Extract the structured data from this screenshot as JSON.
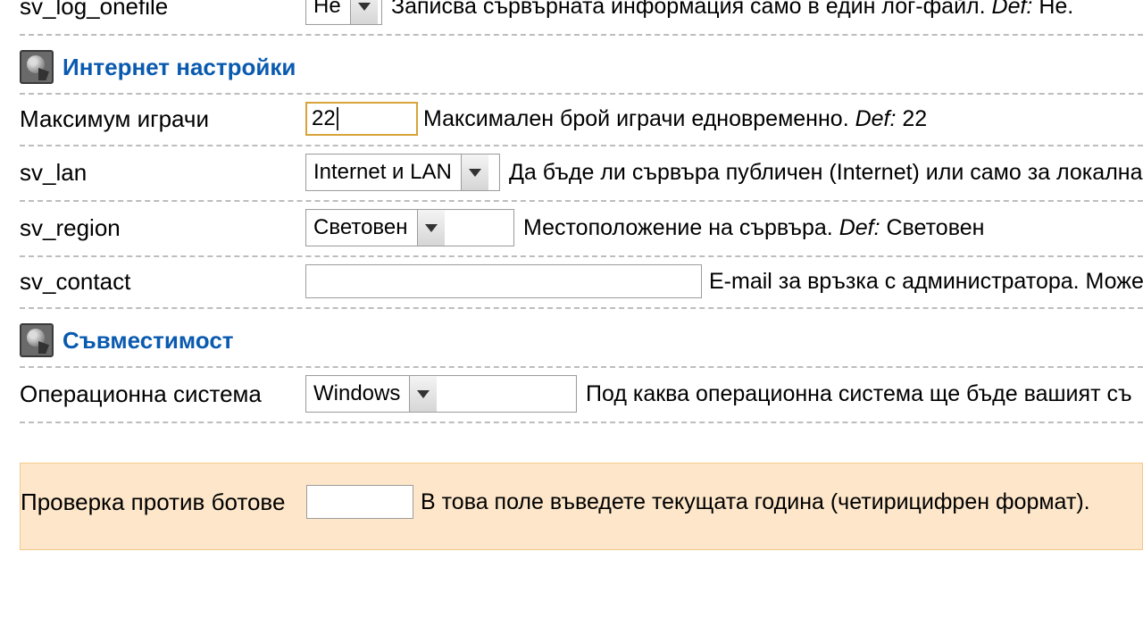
{
  "row_log": {
    "label": "sv_log_onefile",
    "value": "Не",
    "desc": "Записва сървърната информация само в един лог-файл. ",
    "def_label": "Def:",
    "def_value": " Не."
  },
  "section_internet": "Интернет настройки",
  "row_max": {
    "label": "Максимум играчи",
    "value": "22",
    "desc": "Максимален брой играчи едновременно. ",
    "def_label": "Def:",
    "def_value": " 22"
  },
  "row_lan": {
    "label": "sv_lan",
    "value": "Internet и LAN",
    "desc": "Да бъде ли сървъра публичен (Internet) или само за локална"
  },
  "row_region": {
    "label": "sv_region",
    "value": "Световен",
    "desc": "Местоположение на сървъра. ",
    "def_label": "Def:",
    "def_value": " Световен"
  },
  "row_contact": {
    "label": "sv_contact",
    "value": "",
    "desc": "E-mail за връзка с администратора. Може"
  },
  "section_compat": "Съвместимост",
  "row_os": {
    "label": "Операционна система",
    "value": "Windows",
    "desc": "Под каква операционна система ще бъде вашият съ"
  },
  "row_bot": {
    "label": "Проверка против ботове",
    "value": "",
    "desc": "В това поле въведете текущата година (четирицифрен формат)."
  }
}
